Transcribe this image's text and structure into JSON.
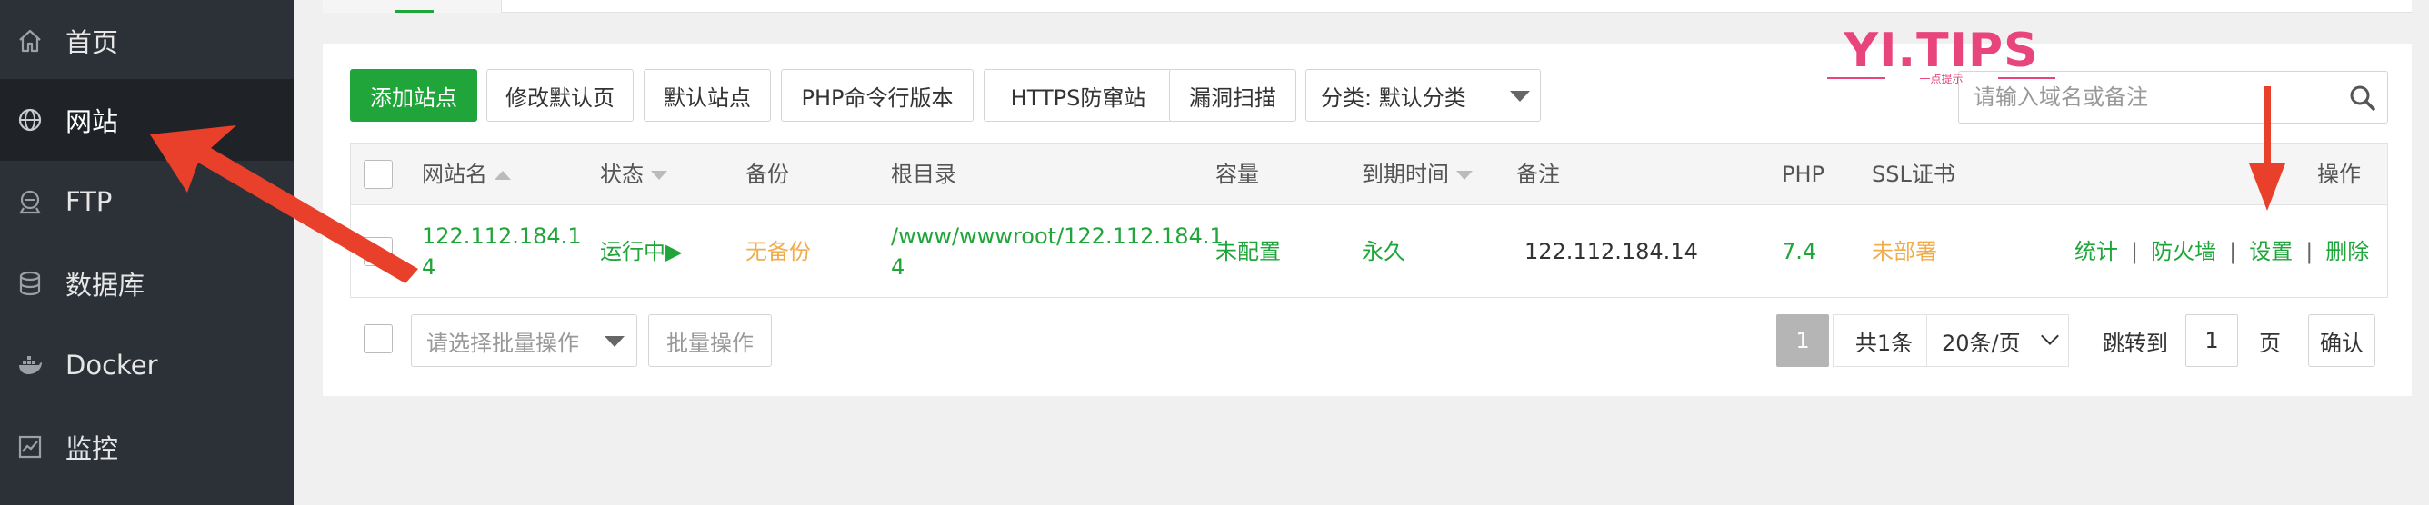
{
  "sidebar": {
    "items": [
      {
        "label": "首页",
        "icon": "home-icon"
      },
      {
        "label": "网站",
        "icon": "globe-icon",
        "active": true
      },
      {
        "label": "FTP",
        "icon": "ftp-icon"
      },
      {
        "label": "数据库",
        "icon": "database-icon"
      },
      {
        "label": "Docker",
        "icon": "docker-icon"
      },
      {
        "label": "监控",
        "icon": "monitor-icon"
      }
    ]
  },
  "toolbar": {
    "add_site": "添加站点",
    "edit_default_page": "修改默认页",
    "default_site": "默认站点",
    "php_cli_version": "PHP命令行版本",
    "https_guard": "HTTPS防窜站",
    "vuln_scan": "漏洞扫描",
    "category_select": "分类: 默认分类"
  },
  "search": {
    "placeholder": "请输入域名或备注"
  },
  "watermark": {
    "text": "YI.TIPS",
    "subtext": "一点提示"
  },
  "table": {
    "headers": {
      "name": "网站名",
      "status": "状态",
      "backup": "备份",
      "root": "根目录",
      "capacity": "容量",
      "expire": "到期时间",
      "remark": "备注",
      "php": "PHP",
      "ssl": "SSL证书",
      "actions": "操作"
    },
    "rows": [
      {
        "name_line1": "122.112.184.1",
        "name_line2": "4",
        "status": "运行中▶",
        "backup": "无备份",
        "root_line1": "/www/wwwroot/122.112.184.1",
        "root_line2": "4",
        "capacity": "未配置",
        "expire": "永久",
        "remark": "122.112.184.14",
        "php": "7.4",
        "ssl": "未部署",
        "actions": {
          "stats": "统计",
          "firewall": "防火墙",
          "settings": "设置",
          "delete": "删除",
          "separator": "|"
        }
      }
    ]
  },
  "footer": {
    "batch_select_placeholder": "请选择批量操作",
    "batch_button": "批量操作",
    "current_page": "1",
    "total": "共1条",
    "per_page": "20条/页",
    "jump_to": "跳转到",
    "jump_value": "1",
    "page_unit": "页",
    "confirm": "确认"
  },
  "colors": {
    "sidebar_bg": "#2c3138",
    "accent_green": "#20a53a",
    "warning_orange": "#f0ad4e",
    "arrow_red": "#e8402a",
    "watermark_pink": "#e8457c"
  }
}
